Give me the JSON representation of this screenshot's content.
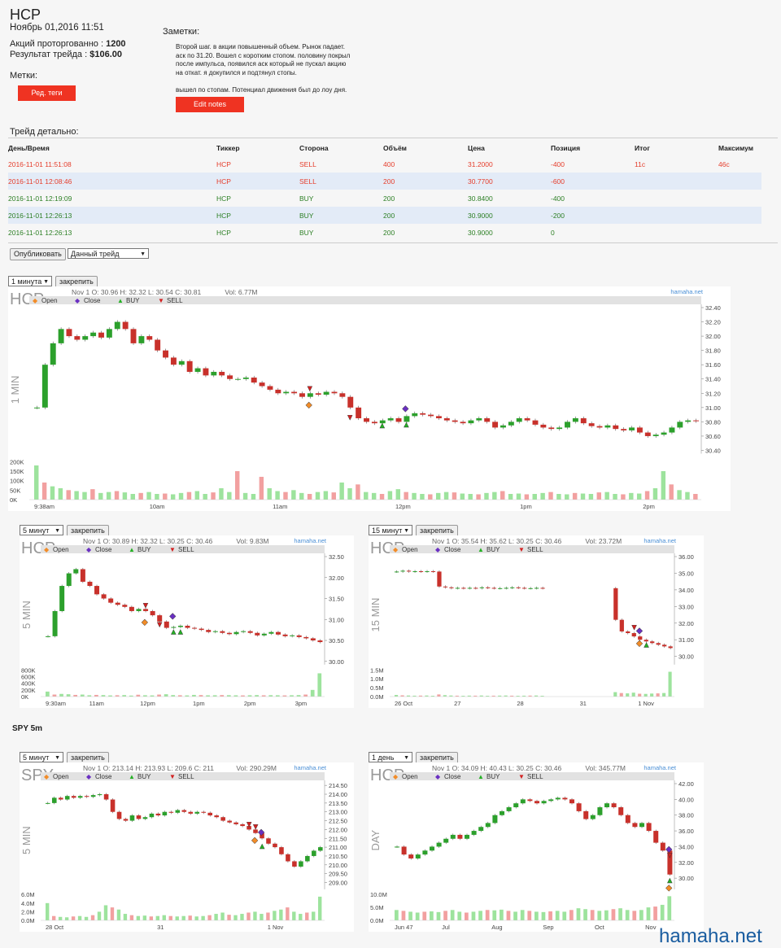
{
  "header": {
    "ticker": "HCP",
    "datetime": "Ноябрь 01,2016 11:51",
    "shares_label": "Акций проторгованно :",
    "shares_value": "1200",
    "result_label": "Результат трейда :",
    "result_value": "$106.00",
    "tags_label": "Метки:",
    "tags_button": "Ред. теги",
    "notes_label": "Заметки:",
    "notes_text": "Второй шаг. в акции повышенный объем. Рынок падает.\nаск по 31.20. Вошел с коротким стопом. половину покрыл\nпосле импульса, появился аск который не пускал акцию\nна откат. я докупился и подтянул стопы.\n\nвышел по стопам. Потенциал движения был до лоу дня.",
    "edit_notes_button": "Edit notes"
  },
  "details": {
    "title": "Трейд детально:",
    "columns": [
      "День/Время",
      "Тиккер",
      "Сторона",
      "Объём",
      "Цена",
      "Позиция",
      "Итог",
      "Максимум"
    ],
    "rows": [
      [
        "2016-11-01 11:51:08",
        "HCP",
        "SELL",
        "400",
        "31.2000",
        "-400",
        "11c",
        "46c"
      ],
      [
        "2016-11-01 12:08:46",
        "HCP",
        "SELL",
        "200",
        "30.7700",
        "-600",
        "",
        ""
      ],
      [
        "2016-11-01 12:19:09",
        "HCP",
        "BUY",
        "200",
        "30.8400",
        "-400",
        "",
        ""
      ],
      [
        "2016-11-01 12:26:13",
        "HCP",
        "BUY",
        "200",
        "30.9000",
        "-200",
        "",
        ""
      ],
      [
        "2016-11-01 12:26:13",
        "HCP",
        "BUY",
        "200",
        "30.9000",
        "0",
        "",
        ""
      ]
    ],
    "row_sides": [
      "sell",
      "sell",
      "buy",
      "buy",
      "buy"
    ]
  },
  "publish": {
    "button": "Опубликовать",
    "select_value": "Данный трейд"
  },
  "legend": {
    "open": "Open",
    "close": "Close",
    "buy": "BUY",
    "sell": "SELL"
  },
  "brand": "hamaha.net",
  "section_spy": "SPY 5m",
  "footer": "hamaha.net",
  "colors": {
    "accent_red": "#ef3322",
    "sell": "#e53d2b",
    "buy": "#2c7f24",
    "up": "#2ca02c",
    "down": "#c8312b"
  },
  "charts": [
    {
      "id": "c1",
      "interval": "1 минута",
      "pin": "закрепить",
      "symbol": "HCP",
      "period_label": "1 MIN",
      "ohlc": "Nov 1 O: 30.96 H: 32.32 L: 30.54 C: 30.81",
      "vol": "Vol: 6.77M",
      "price_ticks": [
        "32.40",
        "32.20",
        "32.00",
        "31.80",
        "31.60",
        "31.40",
        "31.20",
        "31.00",
        "30.80",
        "30.60",
        "30.40"
      ],
      "vol_ticks": [
        "200K",
        "150K",
        "100K",
        "50K",
        "0K"
      ],
      "time_ticks": [
        "9:38am",
        "10am",
        "11am",
        "12pm",
        "1pm",
        "2pm"
      ],
      "series": [
        31.0,
        31.6,
        31.9,
        32.1,
        32.0,
        31.95,
        32.0,
        32.05,
        31.98,
        32.1,
        32.2,
        32.1,
        31.9,
        32.0,
        31.95,
        31.8,
        31.7,
        31.6,
        31.65,
        31.5,
        31.55,
        31.45,
        31.5,
        31.45,
        31.4,
        31.4,
        31.42,
        31.35,
        31.3,
        31.25,
        31.2,
        31.22,
        31.2,
        31.15,
        31.2,
        31.18,
        31.22,
        31.2,
        31.15,
        31.0,
        30.85,
        30.8,
        30.78,
        30.82,
        30.85,
        30.8,
        30.88,
        30.92,
        30.9,
        30.88,
        30.85,
        30.82,
        30.8,
        30.78,
        30.82,
        30.85,
        30.8,
        30.72,
        30.75,
        30.8,
        30.85,
        30.82,
        30.76,
        30.72,
        30.7,
        30.72,
        30.8,
        30.85,
        30.78,
        30.74,
        30.72,
        30.75,
        30.7,
        30.68,
        30.72,
        30.65,
        30.6,
        30.62,
        30.65,
        30.72,
        30.8,
        30.82,
        30.81
      ],
      "volumes": [
        180,
        90,
        70,
        60,
        50,
        45,
        40,
        55,
        35,
        40,
        45,
        38,
        30,
        35,
        40,
        30,
        32,
        28,
        35,
        40,
        45,
        30,
        38,
        60,
        40,
        150,
        35,
        30,
        120,
        60,
        45,
        40,
        50,
        35,
        30,
        40,
        45,
        38,
        90,
        60,
        80,
        40,
        35,
        30,
        45,
        55,
        40,
        35,
        30,
        28,
        35,
        40,
        38,
        32,
        30,
        28,
        35,
        40,
        45,
        30,
        32,
        28,
        30,
        35,
        40,
        30,
        28,
        35,
        32,
        30,
        38,
        40,
        30,
        28,
        35,
        32,
        45,
        60,
        150,
        80,
        50,
        40,
        30
      ],
      "ymin": 30.4,
      "ymax": 32.4,
      "vmax": 200,
      "markers": [
        {
          "type": "sell",
          "i": 34,
          "p": 31.28
        },
        {
          "type": "open",
          "i": 34,
          "p": 31.05
        },
        {
          "type": "sell",
          "i": 39,
          "p": 30.87
        },
        {
          "type": "buy",
          "i": 43,
          "p": 30.76
        },
        {
          "type": "buy",
          "i": 46,
          "p": 30.77
        },
        {
          "type": "close",
          "i": 46,
          "p": 31.0
        }
      ]
    },
    {
      "id": "c2",
      "interval": "5 минут",
      "pin": "закрепить",
      "symbol": "HCP",
      "period_label": "5 MIN",
      "ohlc": "Nov 1 O: 30.89 H: 32.32 L: 30.25 C: 30.46",
      "vol": "Vol: 9.83M",
      "price_ticks": [
        "32.50",
        "32.00",
        "31.50",
        "31.00",
        "30.50",
        "30.00"
      ],
      "vol_ticks": [
        "800K",
        "600K",
        "400K",
        "200K",
        "0K"
      ],
      "time_ticks": [
        "9:30am",
        "11am",
        "12pm",
        "1pm",
        "2pm",
        "3pm"
      ],
      "series": [
        30.6,
        31.2,
        31.8,
        32.1,
        32.2,
        31.9,
        31.8,
        31.6,
        31.5,
        31.4,
        31.35,
        31.3,
        31.2,
        31.25,
        31.2,
        31.1,
        30.95,
        30.8,
        30.82,
        30.85,
        30.8,
        30.78,
        30.75,
        30.7,
        30.72,
        30.68,
        30.65,
        30.7,
        30.72,
        30.68,
        30.62,
        30.66,
        30.7,
        30.64,
        30.6,
        30.62,
        30.58,
        30.55,
        30.5,
        30.46
      ],
      "volumes": [
        150,
        60,
        80,
        70,
        50,
        60,
        40,
        50,
        45,
        35,
        40,
        45,
        30,
        55,
        40,
        35,
        60,
        70,
        45,
        40,
        35,
        50,
        45,
        38,
        40,
        45,
        42,
        38,
        35,
        40,
        45,
        38,
        42,
        40,
        35,
        40,
        45,
        60,
        200,
        700
      ],
      "ymin": 30.0,
      "ymax": 32.5,
      "vmax": 800,
      "markers": [
        {
          "type": "sell",
          "i": 14,
          "p": 31.35
        },
        {
          "type": "open",
          "i": 14,
          "p": 30.96
        },
        {
          "type": "sell",
          "i": 16,
          "p": 30.9
        },
        {
          "type": "close",
          "i": 18,
          "p": 31.1
        },
        {
          "type": "buy",
          "i": 18,
          "p": 30.72
        },
        {
          "type": "buy",
          "i": 19,
          "p": 30.72
        }
      ]
    },
    {
      "id": "c3",
      "interval": "15 минут",
      "pin": "закрепить",
      "symbol": "HCP",
      "period_label": "15 MIN",
      "ohlc": "Nov 1 O: 35.54 H: 35.62 L: 30.25 C: 30.46",
      "vol": "Vol: 23.72M",
      "price_ticks": [
        "36.00",
        "35.00",
        "34.00",
        "33.00",
        "32.00",
        "31.00",
        "30.00"
      ],
      "vol_ticks": [
        "1.5M",
        "1.0M",
        "0.5M",
        "0.0M"
      ],
      "time_ticks": [
        "26 Oct",
        "27",
        "28",
        "31",
        "1 Nov"
      ],
      "series": [
        35.1,
        35.15,
        35.1,
        35.12,
        35.1,
        35.12,
        35.1,
        34.2,
        34.15,
        34.1,
        34.12,
        34.1,
        34.12,
        34.1,
        34.15,
        34.12,
        34.1,
        34.1,
        34.12,
        34.15,
        34.12,
        34.1,
        34.1,
        34.12,
        34.1,
        null,
        null,
        null,
        null,
        null,
        null,
        null,
        null,
        null,
        null,
        null,
        32.2,
        31.5,
        31.4,
        31.2,
        31.0,
        30.9,
        30.8,
        30.7,
        30.6,
        30.5
      ],
      "volumes": [
        90,
        70,
        60,
        50,
        55,
        60,
        45,
        120,
        80,
        60,
        50,
        45,
        55,
        50,
        60,
        45,
        50,
        55,
        60,
        50,
        45,
        50,
        55,
        60,
        45,
        null,
        null,
        null,
        null,
        null,
        null,
        null,
        null,
        null,
        null,
        null,
        250,
        200,
        180,
        220,
        160,
        150,
        170,
        180,
        200,
        1400
      ],
      "ymin": 29.7,
      "ymax": 36.0,
      "vmax": 1500,
      "markers": [
        {
          "type": "sell",
          "i": 39,
          "p": 31.8
        },
        {
          "type": "close",
          "i": 40,
          "p": 31.6
        },
        {
          "type": "open",
          "i": 40,
          "p": 30.85
        },
        {
          "type": "buy",
          "i": 41,
          "p": 30.75
        }
      ]
    },
    {
      "id": "c4",
      "interval": "5 минут",
      "pin": "закрепить",
      "symbol": "SPY",
      "period_label": "5 MIN",
      "ohlc": "Nov 1 O: 213.14 H: 213.93 L: 209.6 C: 211",
      "vol": "Vol: 290.29M",
      "price_ticks": [
        "214.50",
        "214.00",
        "213.50",
        "213.00",
        "212.50",
        "212.00",
        "211.50",
        "211.00",
        "210.50",
        "210.00",
        "209.50",
        "209.00"
      ],
      "vol_ticks": [
        "6.0M",
        "4.0M",
        "2.0M",
        "0.0M"
      ],
      "time_ticks": [
        "28 Oct",
        "31",
        "1 Nov"
      ],
      "series": [
        213.5,
        213.8,
        213.7,
        213.9,
        213.8,
        213.9,
        213.85,
        213.95,
        214.0,
        213.7,
        213.0,
        212.6,
        212.5,
        212.8,
        212.6,
        212.7,
        212.9,
        212.8,
        213.0,
        212.95,
        213.1,
        213.0,
        212.9,
        213.0,
        212.95,
        212.8,
        212.7,
        212.5,
        212.4,
        212.3,
        212.2,
        212.0,
        211.8,
        211.5,
        211.2,
        211.0,
        210.6,
        210.2,
        209.9,
        210.2,
        210.5,
        210.8,
        211.0
      ],
      "volumes": [
        4.0,
        1.0,
        0.8,
        0.7,
        0.9,
        1.0,
        0.8,
        1.2,
        2.0,
        3.5,
        3.0,
        2.5,
        1.5,
        1.2,
        1.0,
        1.1,
        0.9,
        1.0,
        1.2,
        1.0,
        0.9,
        1.0,
        1.1,
        0.9,
        1.0,
        1.2,
        1.5,
        1.8,
        1.3,
        1.2,
        1.5,
        1.8,
        2.0,
        1.5,
        1.8,
        2.2,
        2.5,
        3.0,
        2.0,
        1.5,
        1.8,
        2.0,
        5.5
      ],
      "ymin": 208.8,
      "ymax": 214.6,
      "vmax": 6.0,
      "markers": [
        {
          "type": "sell",
          "i": 31,
          "p": 212.35
        },
        {
          "type": "sell",
          "i": 32,
          "p": 212.2
        },
        {
          "type": "close",
          "i": 33,
          "p": 211.9
        },
        {
          "type": "open",
          "i": 32,
          "p": 211.45
        },
        {
          "type": "buy",
          "i": 33,
          "p": 211.1
        }
      ]
    },
    {
      "id": "c5",
      "interval": "1 день",
      "pin": "закрепить",
      "symbol": "HCP",
      "period_label": "DAY",
      "ohlc": "Nov 1 O: 34.09 H: 40.43 L: 30.25 C: 30.46",
      "vol": "Vol: 345.77M",
      "price_ticks": [
        "42.00",
        "40.00",
        "38.00",
        "36.00",
        "34.00",
        "32.00",
        "30.00"
      ],
      "vol_ticks": [
        "10.0M",
        "5.0M",
        "0.0M"
      ],
      "time_ticks": [
        "Jun 47",
        "Jul",
        "Aug",
        "Sep",
        "Oct",
        "Nov"
      ],
      "series": [
        34.0,
        33.0,
        32.5,
        33.0,
        33.5,
        34.0,
        34.5,
        35.0,
        35.5,
        35.0,
        35.5,
        36.0,
        36.5,
        37.0,
        38.0,
        38.5,
        39.0,
        39.5,
        40.0,
        39.8,
        39.5,
        39.8,
        40.0,
        40.2,
        40.0,
        39.5,
        38.5,
        37.5,
        38.0,
        39.0,
        39.5,
        39.0,
        38.0,
        37.0,
        36.5,
        37.0,
        36.0,
        34.5,
        33.5,
        30.46
      ],
      "volumes": [
        6.0,
        5.5,
        5.0,
        4.5,
        5.0,
        5.2,
        4.8,
        5.5,
        6.0,
        5.0,
        4.5,
        5.0,
        5.5,
        6.0,
        5.8,
        6.2,
        5.5,
        5.0,
        6.0,
        5.5,
        5.0,
        4.8,
        5.2,
        5.5,
        5.0,
        6.0,
        7.0,
        6.5,
        6.0,
        5.5,
        5.8,
        6.5,
        7.0,
        6.0,
        5.5,
        6.0,
        7.5,
        8.0,
        9.0,
        14.0
      ],
      "ymin": 29.0,
      "ymax": 42.0,
      "vmax": 15,
      "markers": [
        {
          "type": "close",
          "i": 39,
          "p": 33.8
        },
        {
          "type": "sell",
          "i": 39,
          "p": 33.0
        },
        {
          "type": "buy",
          "i": 39,
          "p": 29.8
        },
        {
          "type": "open",
          "i": 39,
          "p": 28.9
        }
      ]
    }
  ]
}
